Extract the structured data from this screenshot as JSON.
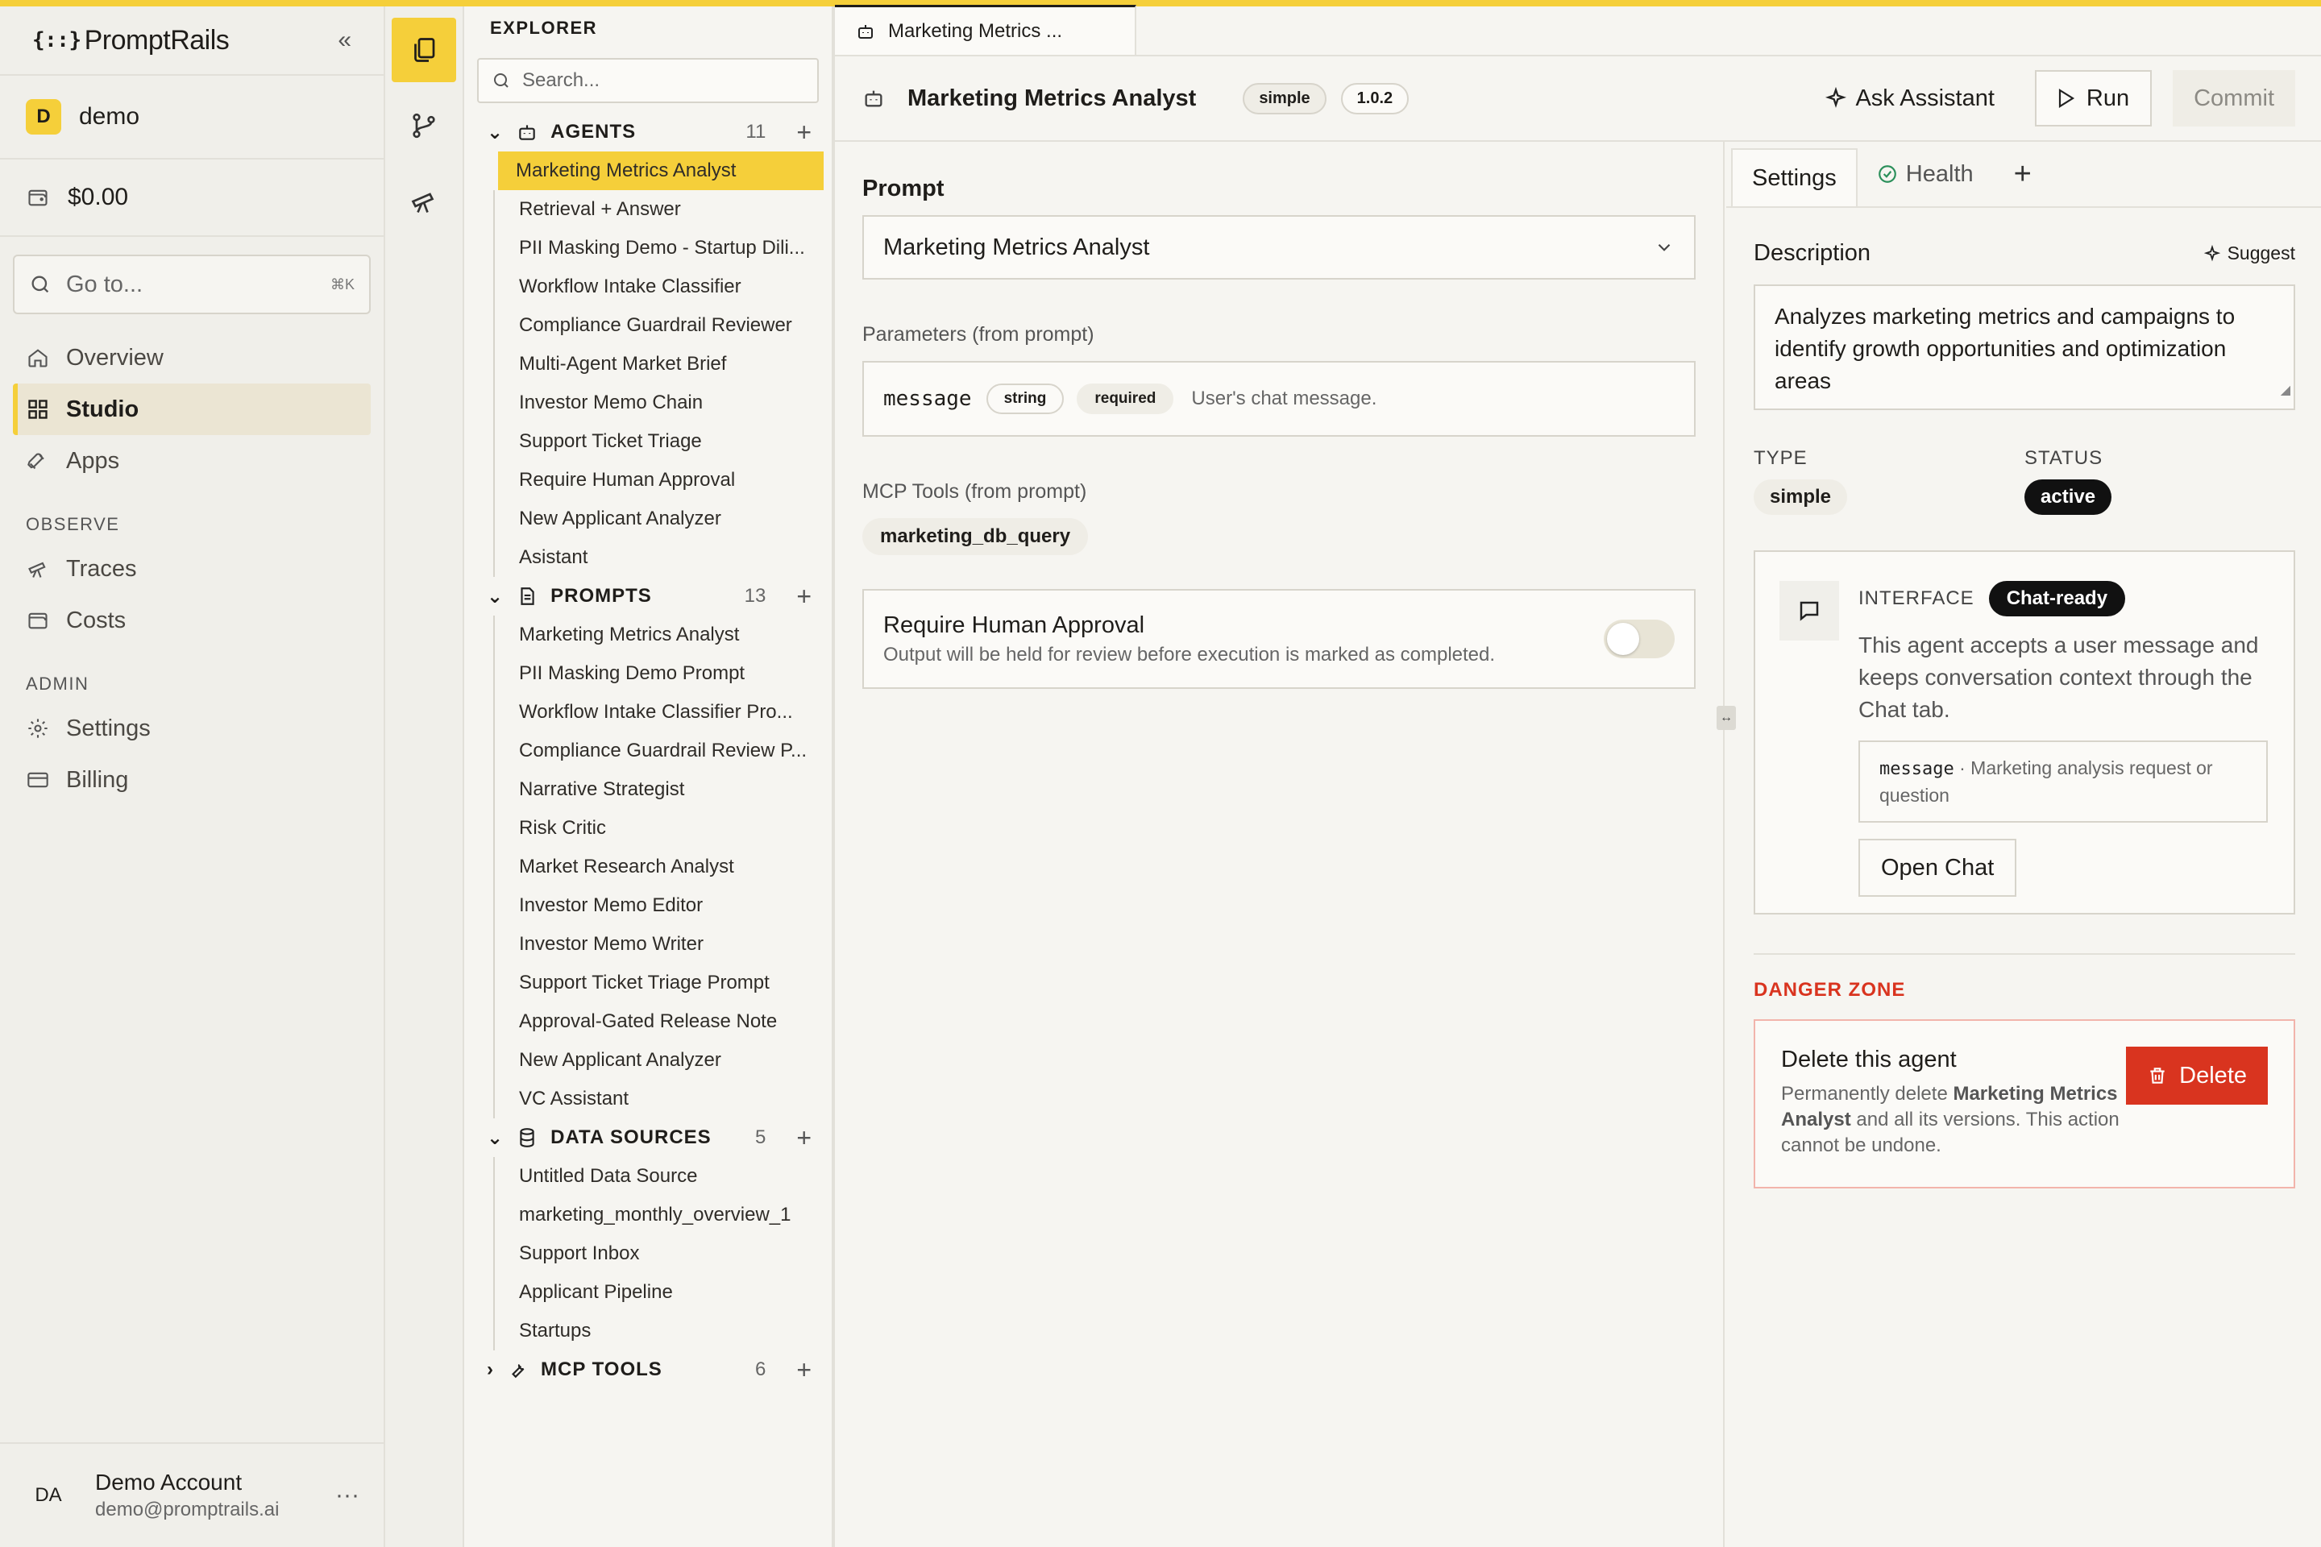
{
  "brand": {
    "name": "PromptRails",
    "mark": "{::}",
    "accent": "#f5cf3a"
  },
  "sidebar": {
    "org": {
      "initial": "D",
      "name": "demo"
    },
    "credits": "$0.00",
    "goto": {
      "placeholder": "Go to...",
      "shortcut": "⌘K"
    },
    "items": [
      {
        "label": "Overview",
        "icon": "home-icon"
      },
      {
        "label": "Studio",
        "icon": "studio-icon",
        "active": true
      },
      {
        "label": "Apps",
        "icon": "rocket-icon"
      }
    ],
    "observe_label": "OBSERVE",
    "observe_items": [
      {
        "label": "Traces",
        "icon": "telescope-icon"
      },
      {
        "label": "Costs",
        "icon": "wallet-icon"
      }
    ],
    "admin_label": "ADMIN",
    "admin_items": [
      {
        "label": "Settings",
        "icon": "gear-icon"
      },
      {
        "label": "Billing",
        "icon": "card-icon"
      }
    ],
    "account": {
      "initials": "DA",
      "name": "Demo Account",
      "email": "demo@promptrails.ai"
    }
  },
  "explorer": {
    "title": "EXPLORER",
    "search_placeholder": "Search...",
    "agents": {
      "label": "AGENTS",
      "count": "11",
      "items": [
        "Marketing Metrics Analyst",
        "Retrieval + Answer",
        "PII Masking Demo - Startup Dili...",
        "Workflow Intake Classifier",
        "Compliance Guardrail Reviewer",
        "Multi-Agent Market Brief",
        "Investor Memo Chain",
        "Support Ticket Triage",
        "Require Human Approval",
        "New Applicant Analyzer",
        "Asistant"
      ]
    },
    "prompts": {
      "label": "PROMPTS",
      "count": "13",
      "items": [
        "Marketing Metrics Analyst",
        "PII Masking Demo Prompt",
        "Workflow Intake Classifier Pro...",
        "Compliance Guardrail Review P...",
        "Narrative Strategist",
        "Risk Critic",
        "Market Research Analyst",
        "Investor Memo Editor",
        "Investor Memo Writer",
        "Support Ticket Triage Prompt",
        "Approval-Gated Release Note",
        "New Applicant Analyzer",
        "VC Assistant"
      ]
    },
    "data_sources": {
      "label": "DATA SOURCES",
      "count": "5",
      "items": [
        "Untitled Data Source",
        "marketing_monthly_overview_1",
        "Support Inbox",
        "Applicant Pipeline",
        "Startups"
      ]
    },
    "mcp_tools": {
      "label": "MCP TOOLS",
      "count": "6"
    }
  },
  "editor": {
    "tab_label": "Marketing Metrics ...",
    "title": "Marketing Metrics Analyst",
    "type_pill": "simple",
    "version_pill": "1.0.2",
    "ask_label": "Ask Assistant",
    "run_label": "Run",
    "commit_label": "Commit",
    "prompt_label": "Prompt",
    "prompt_value": "Marketing Metrics Analyst",
    "params_label": "Parameters (from prompt)",
    "param": {
      "name": "message",
      "type": "string",
      "required": "required",
      "desc": "User's chat message."
    },
    "tools_label": "MCP Tools (from prompt)",
    "tool": "marketing_db_query",
    "approval": {
      "title": "Require Human Approval",
      "desc": "Output will be held for review before execution is marked as completed.",
      "enabled": false
    }
  },
  "panel": {
    "tabs": {
      "settings": "Settings",
      "health": "Health"
    },
    "desc_label": "Description",
    "suggest_label": "Suggest",
    "description": "Analyzes marketing metrics and campaigns to identify growth opportunities and optimization areas",
    "type_label": "TYPE",
    "type_value": "simple",
    "status_label": "STATUS",
    "status_value": "active",
    "interface": {
      "label": "INTERFACE",
      "badge": "Chat-ready",
      "text": "This agent accepts a user message and keeps conversation context through the Chat tab.",
      "param_name": "message",
      "param_desc": "· Marketing analysis request or question",
      "open_chat": "Open Chat"
    },
    "danger": {
      "label": "DANGER ZONE",
      "title": "Delete this agent",
      "desc_a": "Permanently delete ",
      "desc_b": "Marketing Metrics Analyst",
      "desc_c": " and all its versions. This action cannot be undone.",
      "button": "Delete",
      "color": "#d9341f"
    }
  }
}
